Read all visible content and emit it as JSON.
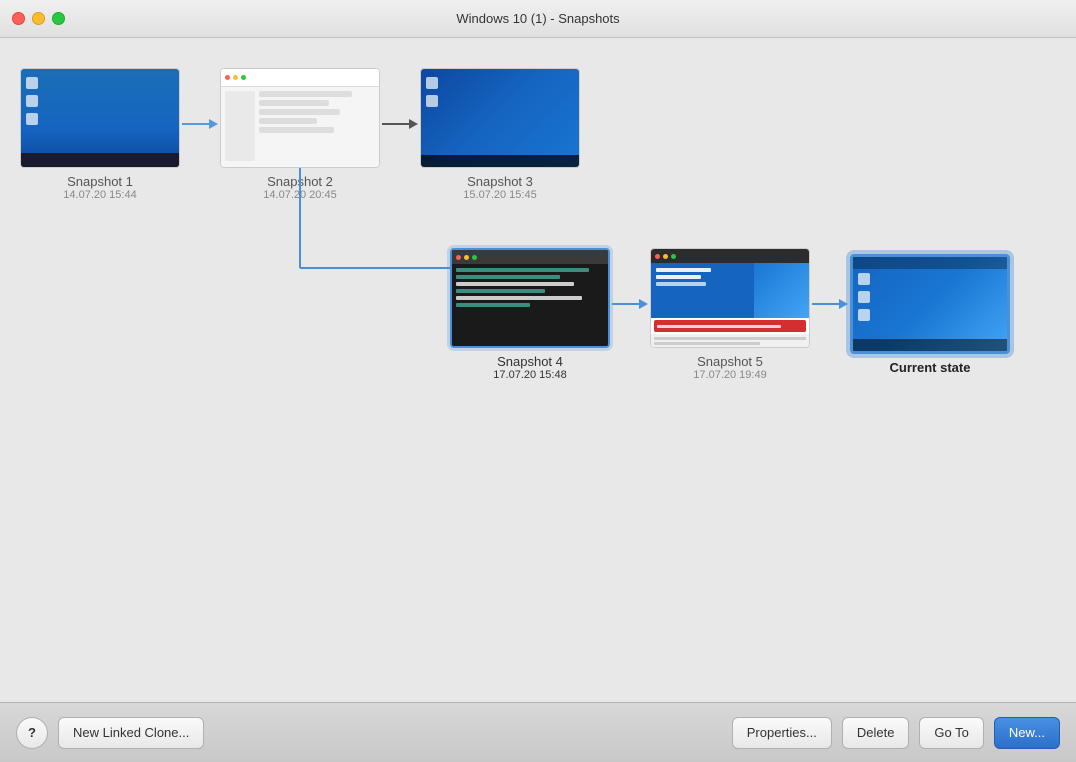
{
  "window": {
    "title": "Windows 10 (1) - Snapshots"
  },
  "snapshots": [
    {
      "id": "snap1",
      "name": "Snapshot 1",
      "date": "14.07.20 15:44",
      "type": "desktop",
      "selected": false,
      "current": false
    },
    {
      "id": "snap2",
      "name": "Snapshot 2",
      "date": "14.07.20 20:45",
      "type": "settings",
      "selected": false,
      "current": false
    },
    {
      "id": "snap3",
      "name": "Snapshot 3",
      "date": "15.07.20 15:45",
      "type": "desktop",
      "selected": false,
      "current": false
    },
    {
      "id": "snap4",
      "name": "Snapshot 4",
      "date": "17.07.20 15:48",
      "type": "terminal",
      "selected": true,
      "current": false
    },
    {
      "id": "snap5",
      "name": "Snapshot 5",
      "date": "17.07.20 19:49",
      "type": "web",
      "selected": false,
      "current": false
    },
    {
      "id": "current",
      "name": "Current state",
      "date": "",
      "type": "current",
      "selected": false,
      "current": true
    }
  ],
  "toolbar": {
    "help_label": "?",
    "new_linked_clone_label": "New Linked Clone...",
    "properties_label": "Properties...",
    "delete_label": "Delete",
    "goto_label": "Go To",
    "new_label": "New..."
  }
}
